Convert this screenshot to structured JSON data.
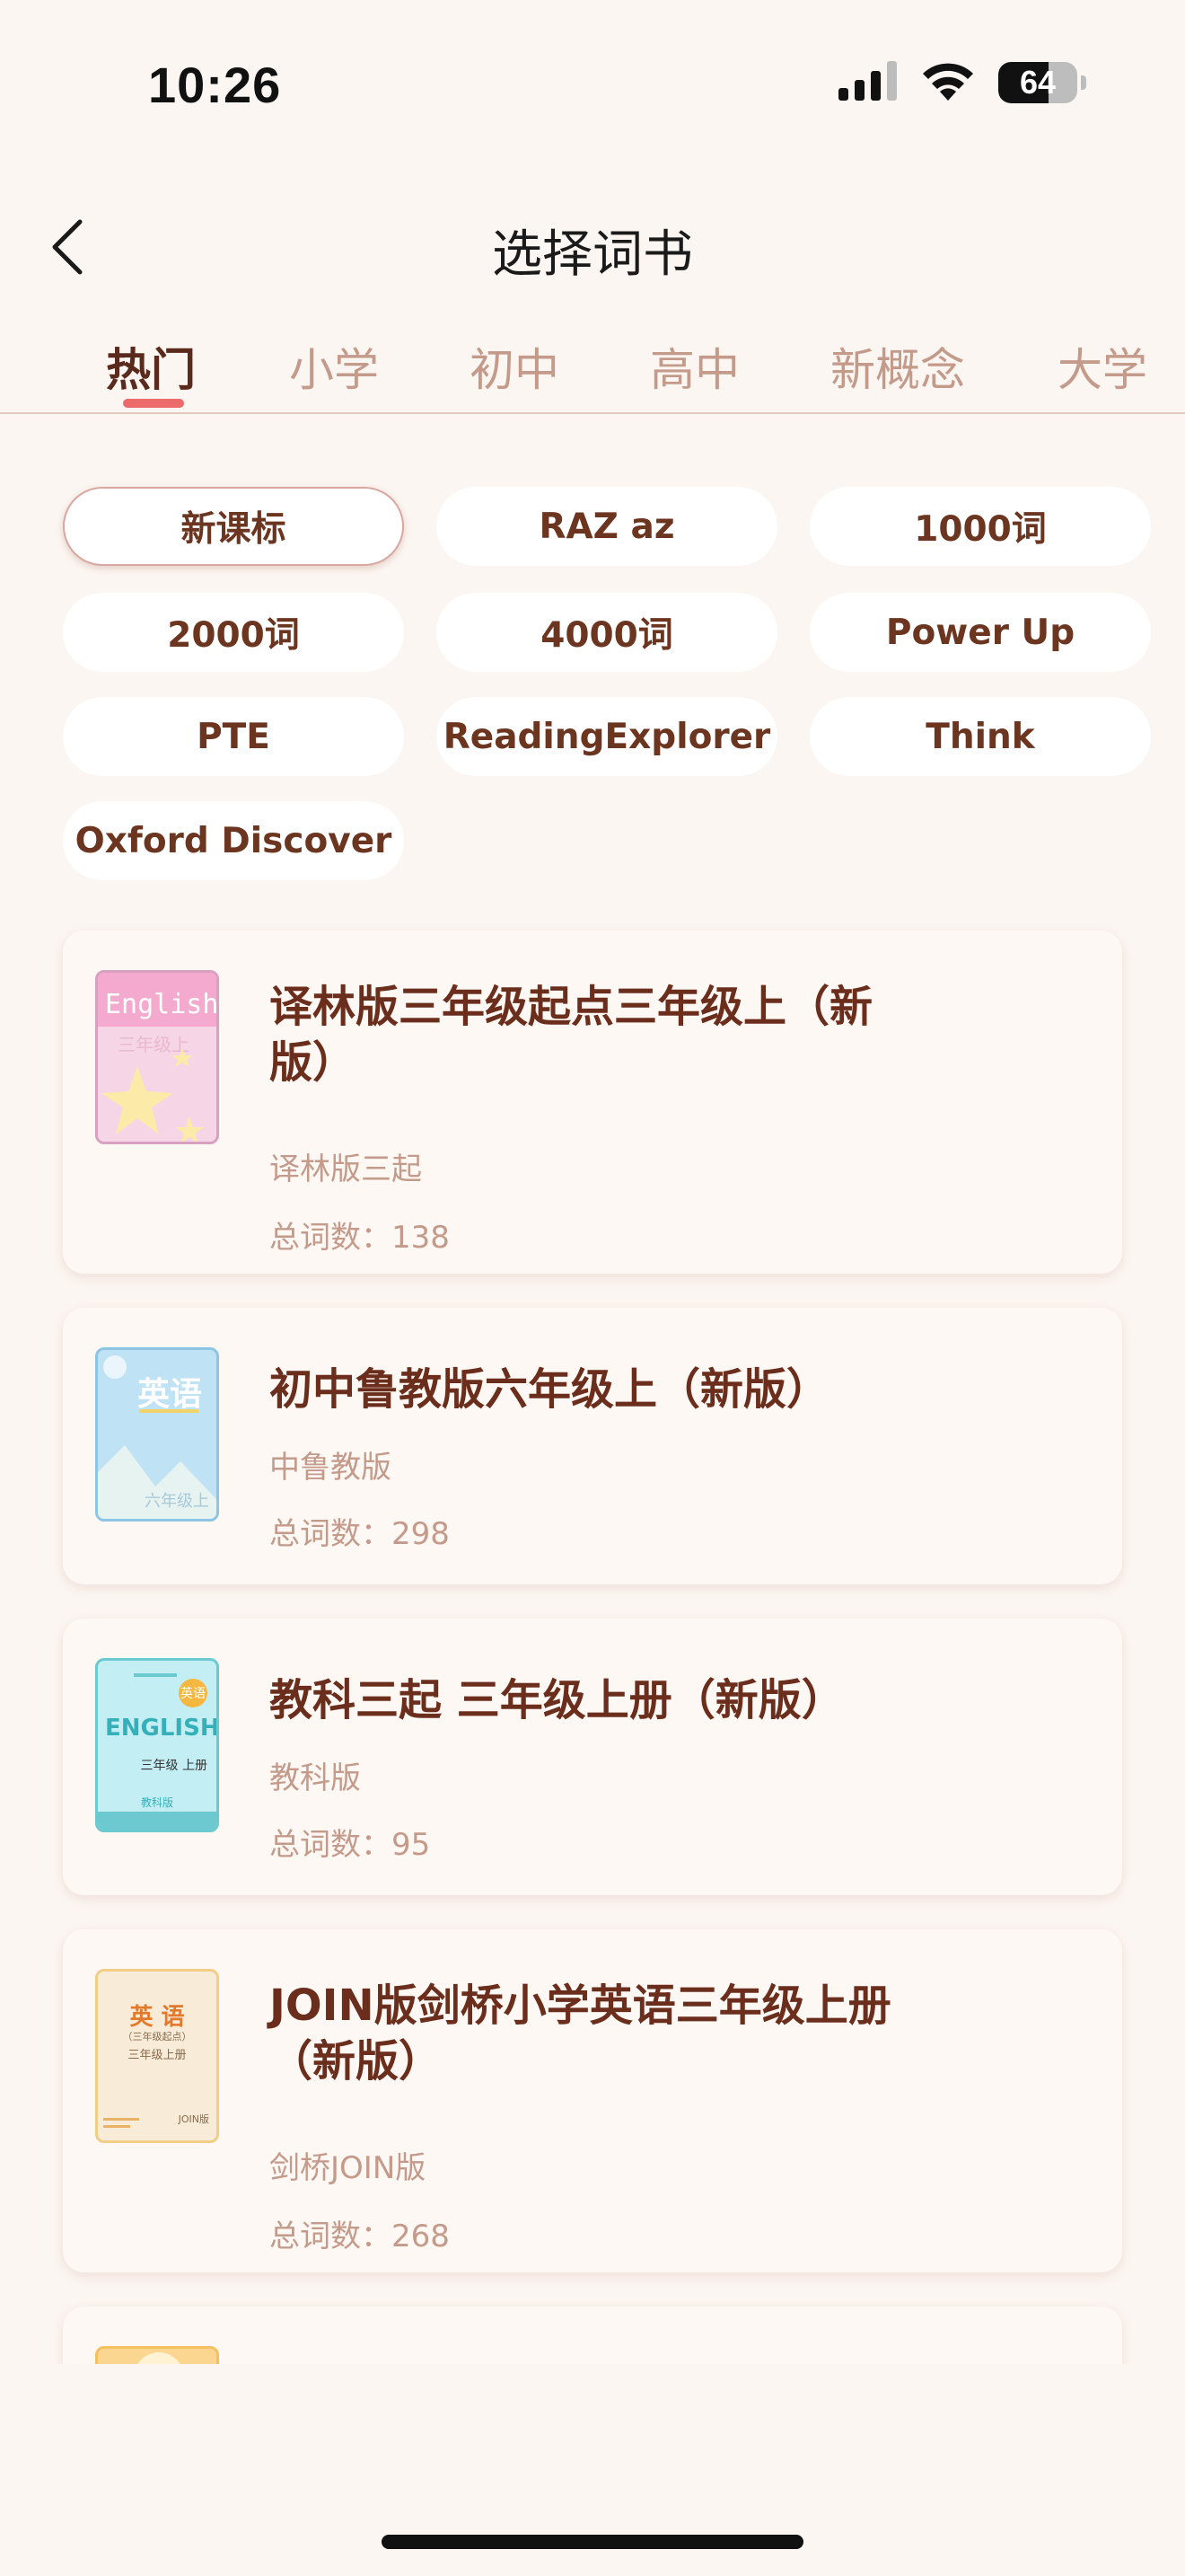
{
  "status_bar": {
    "time": "10:26",
    "battery": "64",
    "battery_level": 0.64
  },
  "nav": {
    "title": "选择词书"
  },
  "tabs": [
    {
      "label": "热门",
      "active": true
    },
    {
      "label": "小学"
    },
    {
      "label": "初中"
    },
    {
      "label": "高中"
    },
    {
      "label": "新概念"
    },
    {
      "label": "大学"
    }
  ],
  "chips": [
    {
      "label": "新课标",
      "selected": true
    },
    {
      "label": "RAZ az"
    },
    {
      "label": "1000词"
    },
    {
      "label": "2000词"
    },
    {
      "label": "4000词"
    },
    {
      "label": "Power Up"
    },
    {
      "label": "PTE"
    },
    {
      "label": "ReadingExplorer"
    },
    {
      "label": "Think"
    },
    {
      "label": "Oxford Discover"
    }
  ],
  "books": [
    {
      "title": "译林版三年级起点三年级上（新版）",
      "publisher": "译林版三起",
      "count": "总词数：138",
      "cover": {
        "word": "English",
        "grade": "三年级上",
        "color": "#f6d5e6"
      }
    },
    {
      "title": "初中鲁教版六年级上（新版）",
      "publisher": "中鲁教版",
      "count": "总词数：298",
      "cover": {
        "word": "英语",
        "grade": "六年级上",
        "color": "#bfe2f5"
      }
    },
    {
      "title": "教科三起 三年级上册（新版）",
      "publisher": "教科版",
      "count": "总词数：95",
      "cover": {
        "word": "ENGLISH",
        "grade": "三年级 上册",
        "badge": "英语",
        "footer": "教科版",
        "color": "#c3eef4"
      }
    },
    {
      "title": "JOIN版剑桥小学英语三年级上册（新版）",
      "publisher": "剑桥JOIN版",
      "count": "总词数：268",
      "cover": {
        "word": "英 语",
        "subtitle": "（三年级起点）",
        "grade": "三年级上册",
        "footer": "JOIN版",
        "color": "#f8ecd9"
      }
    }
  ]
}
